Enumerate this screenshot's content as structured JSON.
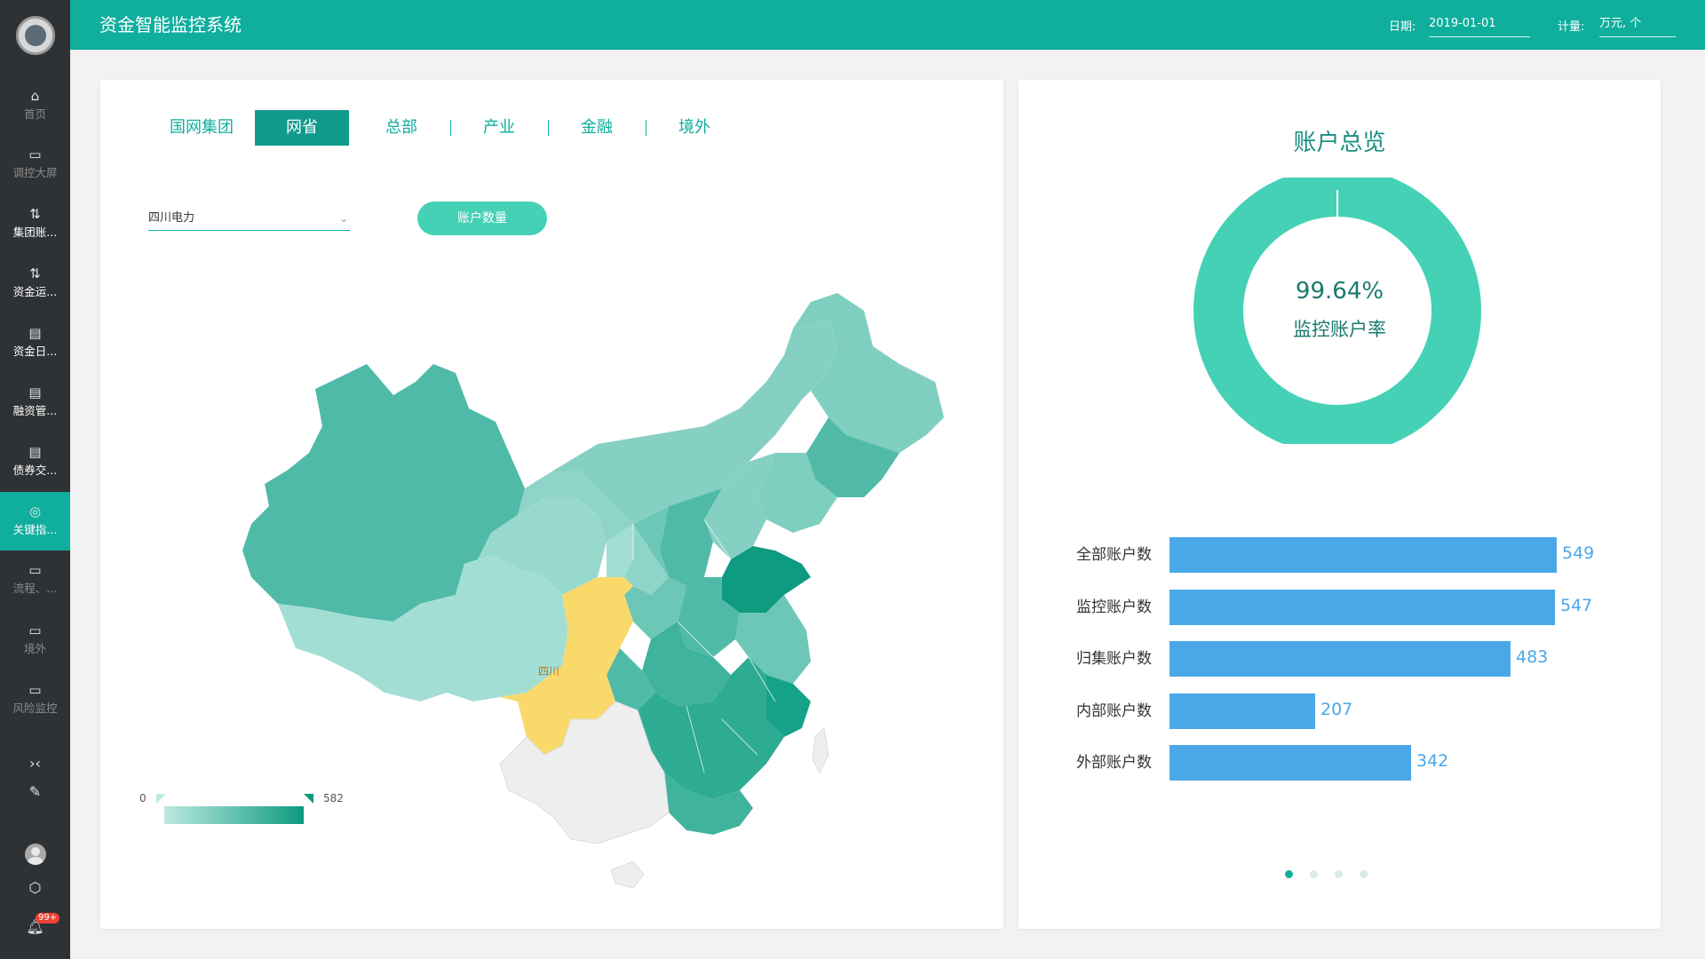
{
  "app": {
    "title": "资金智能监控系统"
  },
  "header": {
    "date_label": "日期:",
    "date_value": "2019-01-01",
    "unit_label": "计量:",
    "unit_value": "万元, 个"
  },
  "sidebar": {
    "items": [
      {
        "label": "首页",
        "icon": "home-icon"
      },
      {
        "label": "调控大屏",
        "icon": "folder-icon"
      },
      {
        "label": "集团账...",
        "icon": "link-icon"
      },
      {
        "label": "资金运...",
        "icon": "link-icon"
      },
      {
        "label": "资金日...",
        "icon": "document-icon"
      },
      {
        "label": "融资管...",
        "icon": "document-icon"
      },
      {
        "label": "债券交...",
        "icon": "document-icon"
      },
      {
        "label": "关键指...",
        "icon": "gauge-icon"
      },
      {
        "label": "流程、...",
        "icon": "folder-icon"
      },
      {
        "label": "境外",
        "icon": "folder-icon"
      },
      {
        "label": "风险监控",
        "icon": "folder-icon"
      }
    ],
    "badge": "99+"
  },
  "tabs": [
    "国网集团",
    "网省",
    "总部",
    "产业",
    "金融",
    "境外"
  ],
  "active_tab": "网省",
  "filter": {
    "selected": "四川电力"
  },
  "metric_button": "账户数量",
  "map": {
    "highlight_region": "四川",
    "legend_min": "0",
    "legend_max": "582",
    "colors": {
      "highlight": "#fad96b",
      "nodata": "#eeeeee",
      "low": "#bde9e1",
      "high": "#0f9a7f"
    }
  },
  "overview": {
    "title": "账户总览",
    "rate_value": "99.64%",
    "rate_label": "监控账户率"
  },
  "chart_data": {
    "type": "bar",
    "orientation": "horizontal",
    "categories": [
      "全部账户数",
      "监控账户数",
      "归集账户数",
      "内部账户数",
      "外部账户数"
    ],
    "values": [
      549,
      547,
      483,
      207,
      342
    ],
    "color": "#4aa8e8"
  },
  "pagination": {
    "total": 4,
    "active": 1
  }
}
